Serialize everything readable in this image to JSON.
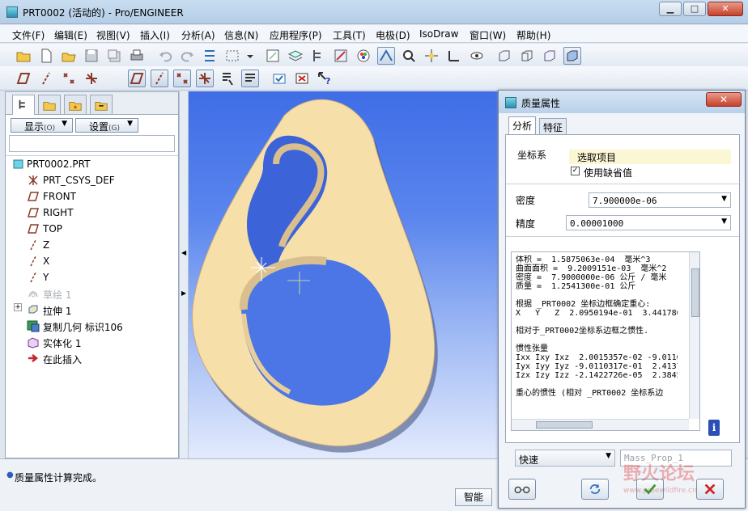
{
  "window": {
    "title": "PRT0002 (活动的) - Pro/ENGINEER",
    "min": "▁",
    "max": "□",
    "close": "✕"
  },
  "menu": [
    "文件(F)",
    "编辑(E)",
    "视图(V)",
    "插入(I)",
    "分析(A)",
    "信息(N)",
    "应用程序(P)",
    "工具(T)",
    "电极(D)",
    "IsoDraw",
    "窗口(W)",
    "帮助(H)"
  ],
  "left_panel": {
    "show_label": "显示",
    "show_shortcut": "(O)",
    "settings_label": "设置",
    "settings_shortcut": "(G)",
    "tree": [
      {
        "label": "PRT0002.PRT",
        "icon": "part-icon",
        "greyed": false
      },
      {
        "label": "PRT_CSYS_DEF",
        "icon": "csys-icon",
        "greyed": false
      },
      {
        "label": "FRONT",
        "icon": "datum-plane-icon",
        "greyed": false
      },
      {
        "label": "RIGHT",
        "icon": "datum-plane-icon",
        "greyed": false
      },
      {
        "label": "TOP",
        "icon": "datum-plane-icon",
        "greyed": false
      },
      {
        "label": "Z",
        "icon": "datum-axis-icon",
        "greyed": false
      },
      {
        "label": "X",
        "icon": "datum-axis-icon",
        "greyed": false
      },
      {
        "label": "Y",
        "icon": "datum-axis-icon",
        "greyed": false
      },
      {
        "label": "草绘 1",
        "icon": "sketch-icon",
        "greyed": true
      },
      {
        "label": "拉伸 1",
        "icon": "extrude-icon",
        "greyed": false,
        "expandable": true
      },
      {
        "label": "复制几何 标识106",
        "icon": "copy-geometry-icon",
        "greyed": false
      },
      {
        "label": "实体化 1",
        "icon": "solidify-icon",
        "greyed": false
      },
      {
        "label": "在此插入",
        "icon": "insert-here-arrow-icon",
        "greyed": false
      }
    ]
  },
  "status": {
    "message": "质量属性计算完成。",
    "filter": "智能"
  },
  "dialog": {
    "title": "质量属性",
    "close": "✕",
    "tabs": [
      "分析",
      "特征"
    ],
    "csys_label": "坐标系",
    "select_item": "选取项目",
    "use_default": "使用缺省值",
    "density_label": "密度",
    "density_value": "7.900000e-06",
    "accuracy_label": "精度",
    "accuracy_value": "0.00001000",
    "output_lines": [
      "体积 =  1.5875063e-04  毫米^3",
      "曲面面积 =  9.2009151e-03  毫米^2",
      "密度 =  7.9000000e-06 公斤 / 毫米",
      "质量 =  1.2541300e-01 公斤",
      "",
      "根据 _PRT0002 坐标边框确定重心:",
      "X   Y   Z  2.0950194e-01  3.441780",
      "",
      "相对于_PRT0002坐标系边框之惯性.",
      "",
      "惯性张量",
      "Ixx Ixy Ixz  2.0015357e-02 -9.0110",
      "Iyx Iyy Iyz -9.0110317e-01  2.4137",
      "Izx Izy Izz -2.1422726e-05  2.3845",
      "",
      "重心的惯性 (相对 _PRT0002 坐标系边"
    ],
    "mode_value": "快速",
    "name_value": "Mass_Prop_1"
  },
  "watermark": {
    "text": "野火论坛",
    "url": "www.proewildfire.cn"
  },
  "colors": {
    "part": "#f7dfaa",
    "part_edge": "#c9a97a",
    "viewport_top": "#3f6de6",
    "viewport_bottom": "#e2eafc"
  }
}
